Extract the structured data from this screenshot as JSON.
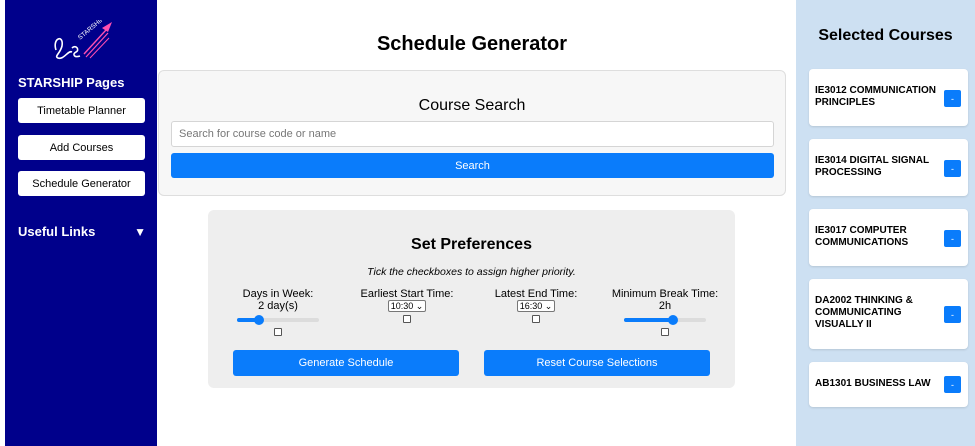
{
  "sidebar": {
    "logo_text": "STARSHIP",
    "title": "STARSHIP Pages",
    "buttons": [
      "Timetable Planner",
      "Add Courses",
      "Schedule Generator"
    ],
    "useful_links": "Useful Links",
    "useful_links_icon": "triangle-down-icon"
  },
  "main": {
    "title": "Schedule Generator",
    "search": {
      "title": "Course Search",
      "placeholder": "Search for course code or name",
      "button": "Search"
    },
    "preferences": {
      "title": "Set Preferences",
      "subtitle": "Tick the checkboxes to assign higher priority.",
      "days": {
        "label": "Days in Week:",
        "value": "2 day(s)",
        "slider_fraction": 0.27
      },
      "start": {
        "label": "Earliest Start Time:",
        "value": "10:30"
      },
      "end": {
        "label": "Latest End Time:",
        "value": "16:30"
      },
      "break": {
        "label": "Minimum Break Time:",
        "value": "2h",
        "slider_fraction": 0.6
      },
      "generate_button": "Generate Schedule",
      "reset_button": "Reset Course Selections"
    }
  },
  "selected": {
    "title": "Selected Courses",
    "remove_label": "-",
    "courses": [
      "IE3012 COMMUNICATION PRINCIPLES",
      "IE3014 DIGITAL SIGNAL PROCESSING",
      "IE3017 COMPUTER COMMUNICATIONS",
      "DA2002 THINKING & COMMUNICATING VISUALLY II",
      "AB1301 BUSINESS LAW"
    ]
  },
  "colors": {
    "sidebar": "#00008b",
    "accent": "#0a7cfb",
    "right_panel": "#cde0f2"
  }
}
